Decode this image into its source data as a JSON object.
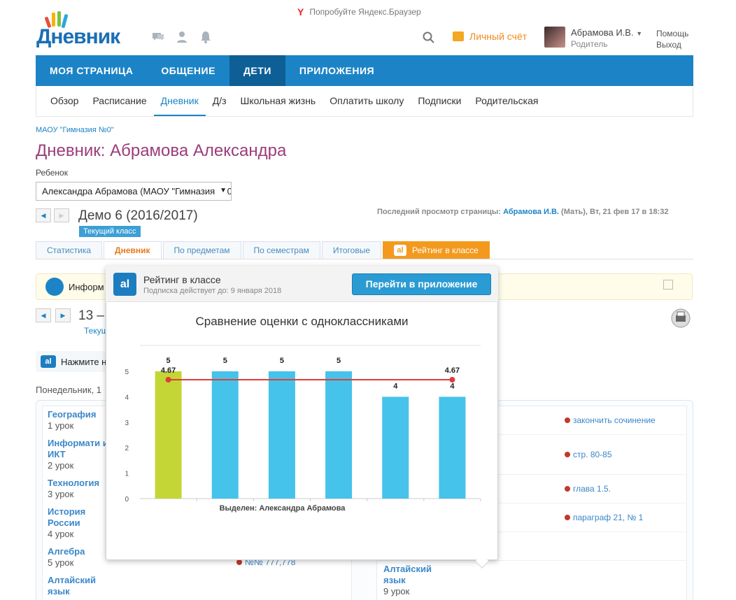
{
  "top": {
    "yandex_hint": "Попробуйте Яндекс.Браузер",
    "logo_text": "Дневник",
    "wallet": "Личный счёт",
    "user_name": "Абрамова И.В.",
    "user_role": "Родитель",
    "help": "Помощь",
    "exit": "Выход"
  },
  "mainnav": [
    "МОЯ СТРАНИЦА",
    "ОБЩЕНИЕ",
    "ДЕТИ",
    "ПРИЛОЖЕНИЯ"
  ],
  "subnav": [
    "Обзор",
    "Расписание",
    "Дневник",
    "Д/з",
    "Школьная жизнь",
    "Оплатить школу",
    "Подписки",
    "Родительская"
  ],
  "school": "МАОУ \"Гимназия №0\"",
  "page_title": "Дневник: Абрамова Александра",
  "child_label": "Ребенок",
  "child_select": "Александра Абрамова (МАОУ \"Гимназия №0\")",
  "year": "Демо 6 (2016/2017)",
  "current_class": "Текущий класс",
  "last_view": {
    "prefix": "Последний просмотр страницы:",
    "who": "Абрамова И.В.",
    "suffix": "(Мать), Вт, 21 фев 17 в 18:32"
  },
  "tabs": [
    "Статистика",
    "Дневник",
    "По предметам",
    "По семестрам",
    "Итоговые",
    "Рейтинг в классе"
  ],
  "info_text": "Информ",
  "week": {
    "title": "13 –",
    "sub": "Текущ"
  },
  "press_text": "Нажмите н",
  "day_label": "Понедельник, 1",
  "lessons_left": [
    {
      "name": "География",
      "count": "1 урок"
    },
    {
      "name": "Информати и ИКТ",
      "count": "2 урок"
    },
    {
      "name": "Технология",
      "count": "3 урок"
    },
    {
      "name": "История России",
      "count": "4 урок"
    },
    {
      "name": "Алгебра",
      "count": "5 урок"
    },
    {
      "name": "Алтайский язык",
      "count": ""
    }
  ],
  "homework": [
    "закончить сочинение",
    "стр. 80-85",
    "глава 1.5.",
    "параграф 21, № 1",
    "№№ 777,778"
  ],
  "right_lesson": {
    "name": "Алтайский язык",
    "count": "9 урок"
  },
  "popup": {
    "logo": "al",
    "title": "Рейтинг в классе",
    "subtitle": "Подписка действует до: 9 января 2018",
    "button": "Перейти в приложение"
  },
  "chart_data": {
    "type": "bar",
    "title": "Сравнение оценки с одноклассниками",
    "xlabel": "Выделен: Александра Абрамова",
    "ylabel": "",
    "ylim": [
      0,
      5
    ],
    "yticks": [
      0,
      1,
      2,
      3,
      4,
      5
    ],
    "values": [
      5,
      5,
      5,
      5,
      4,
      4
    ],
    "highlight_index": 0,
    "highlight_color": "#c3d636",
    "bar_color": "#45c3ea",
    "average": {
      "value": 4.67,
      "label_start": "4.67",
      "label_end": "4.67",
      "color": "#e23b3b"
    }
  },
  "colors": {
    "brand_blue": "#1c84c6",
    "nav_active": "#0d5f95",
    "orange": "#f39a1e",
    "title_purple": "#9b3d7a"
  }
}
